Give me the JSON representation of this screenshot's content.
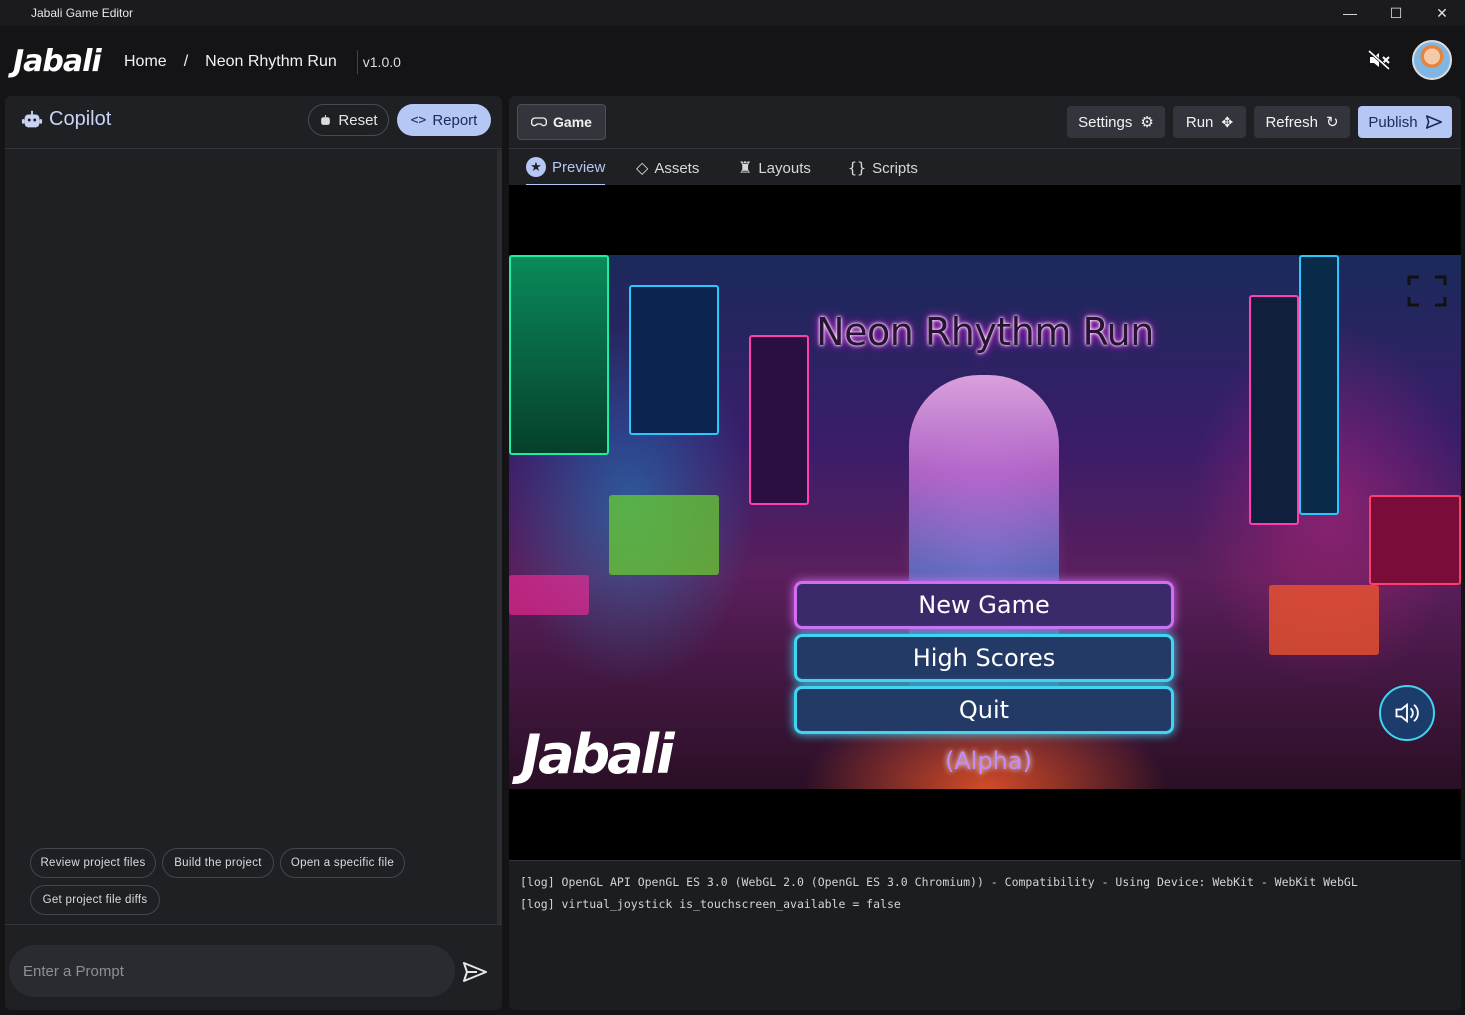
{
  "window": {
    "title": "Jabali Game Editor",
    "controls": [
      "—",
      "☐",
      "✕"
    ]
  },
  "header": {
    "logo": "Jabali",
    "breadcrumb": {
      "home": "Home",
      "separator": "/",
      "project": "Neon Rhythm Run"
    },
    "version": "v1.0.0"
  },
  "copilot": {
    "title": "Copilot",
    "reset_label": "Reset",
    "report_label": "Report",
    "suggestions": [
      "Review project files",
      "Build the project",
      "Open a specific file",
      "Get project file diffs"
    ],
    "prompt_placeholder": "Enter a Prompt"
  },
  "editor": {
    "game_tab": "Game",
    "toolbar": {
      "settings": "Settings",
      "run": "Run",
      "refresh": "Refresh",
      "publish": "Publish"
    },
    "subtabs": [
      "Preview",
      "Assets",
      "Layouts",
      "Scripts"
    ],
    "active_subtab": "Preview"
  },
  "game": {
    "title": "Neon Rhythm Run",
    "menu": [
      "New Game",
      "High Scores",
      "Quit"
    ],
    "badge": "(Alpha)",
    "logo": "Jabali"
  },
  "console": {
    "lines": [
      "[log] OpenGL API OpenGL ES 3.0 (WebGL 2.0 (OpenGL ES 3.0 Chromium)) - Compatibility - Using Device: WebKit - WebKit WebGL",
      "[log] virtual_joystick is_touchscreen_available = false"
    ]
  },
  "colors": {
    "accent": "#b5c7f5",
    "panel": "#1f2024",
    "background": "#141416"
  }
}
